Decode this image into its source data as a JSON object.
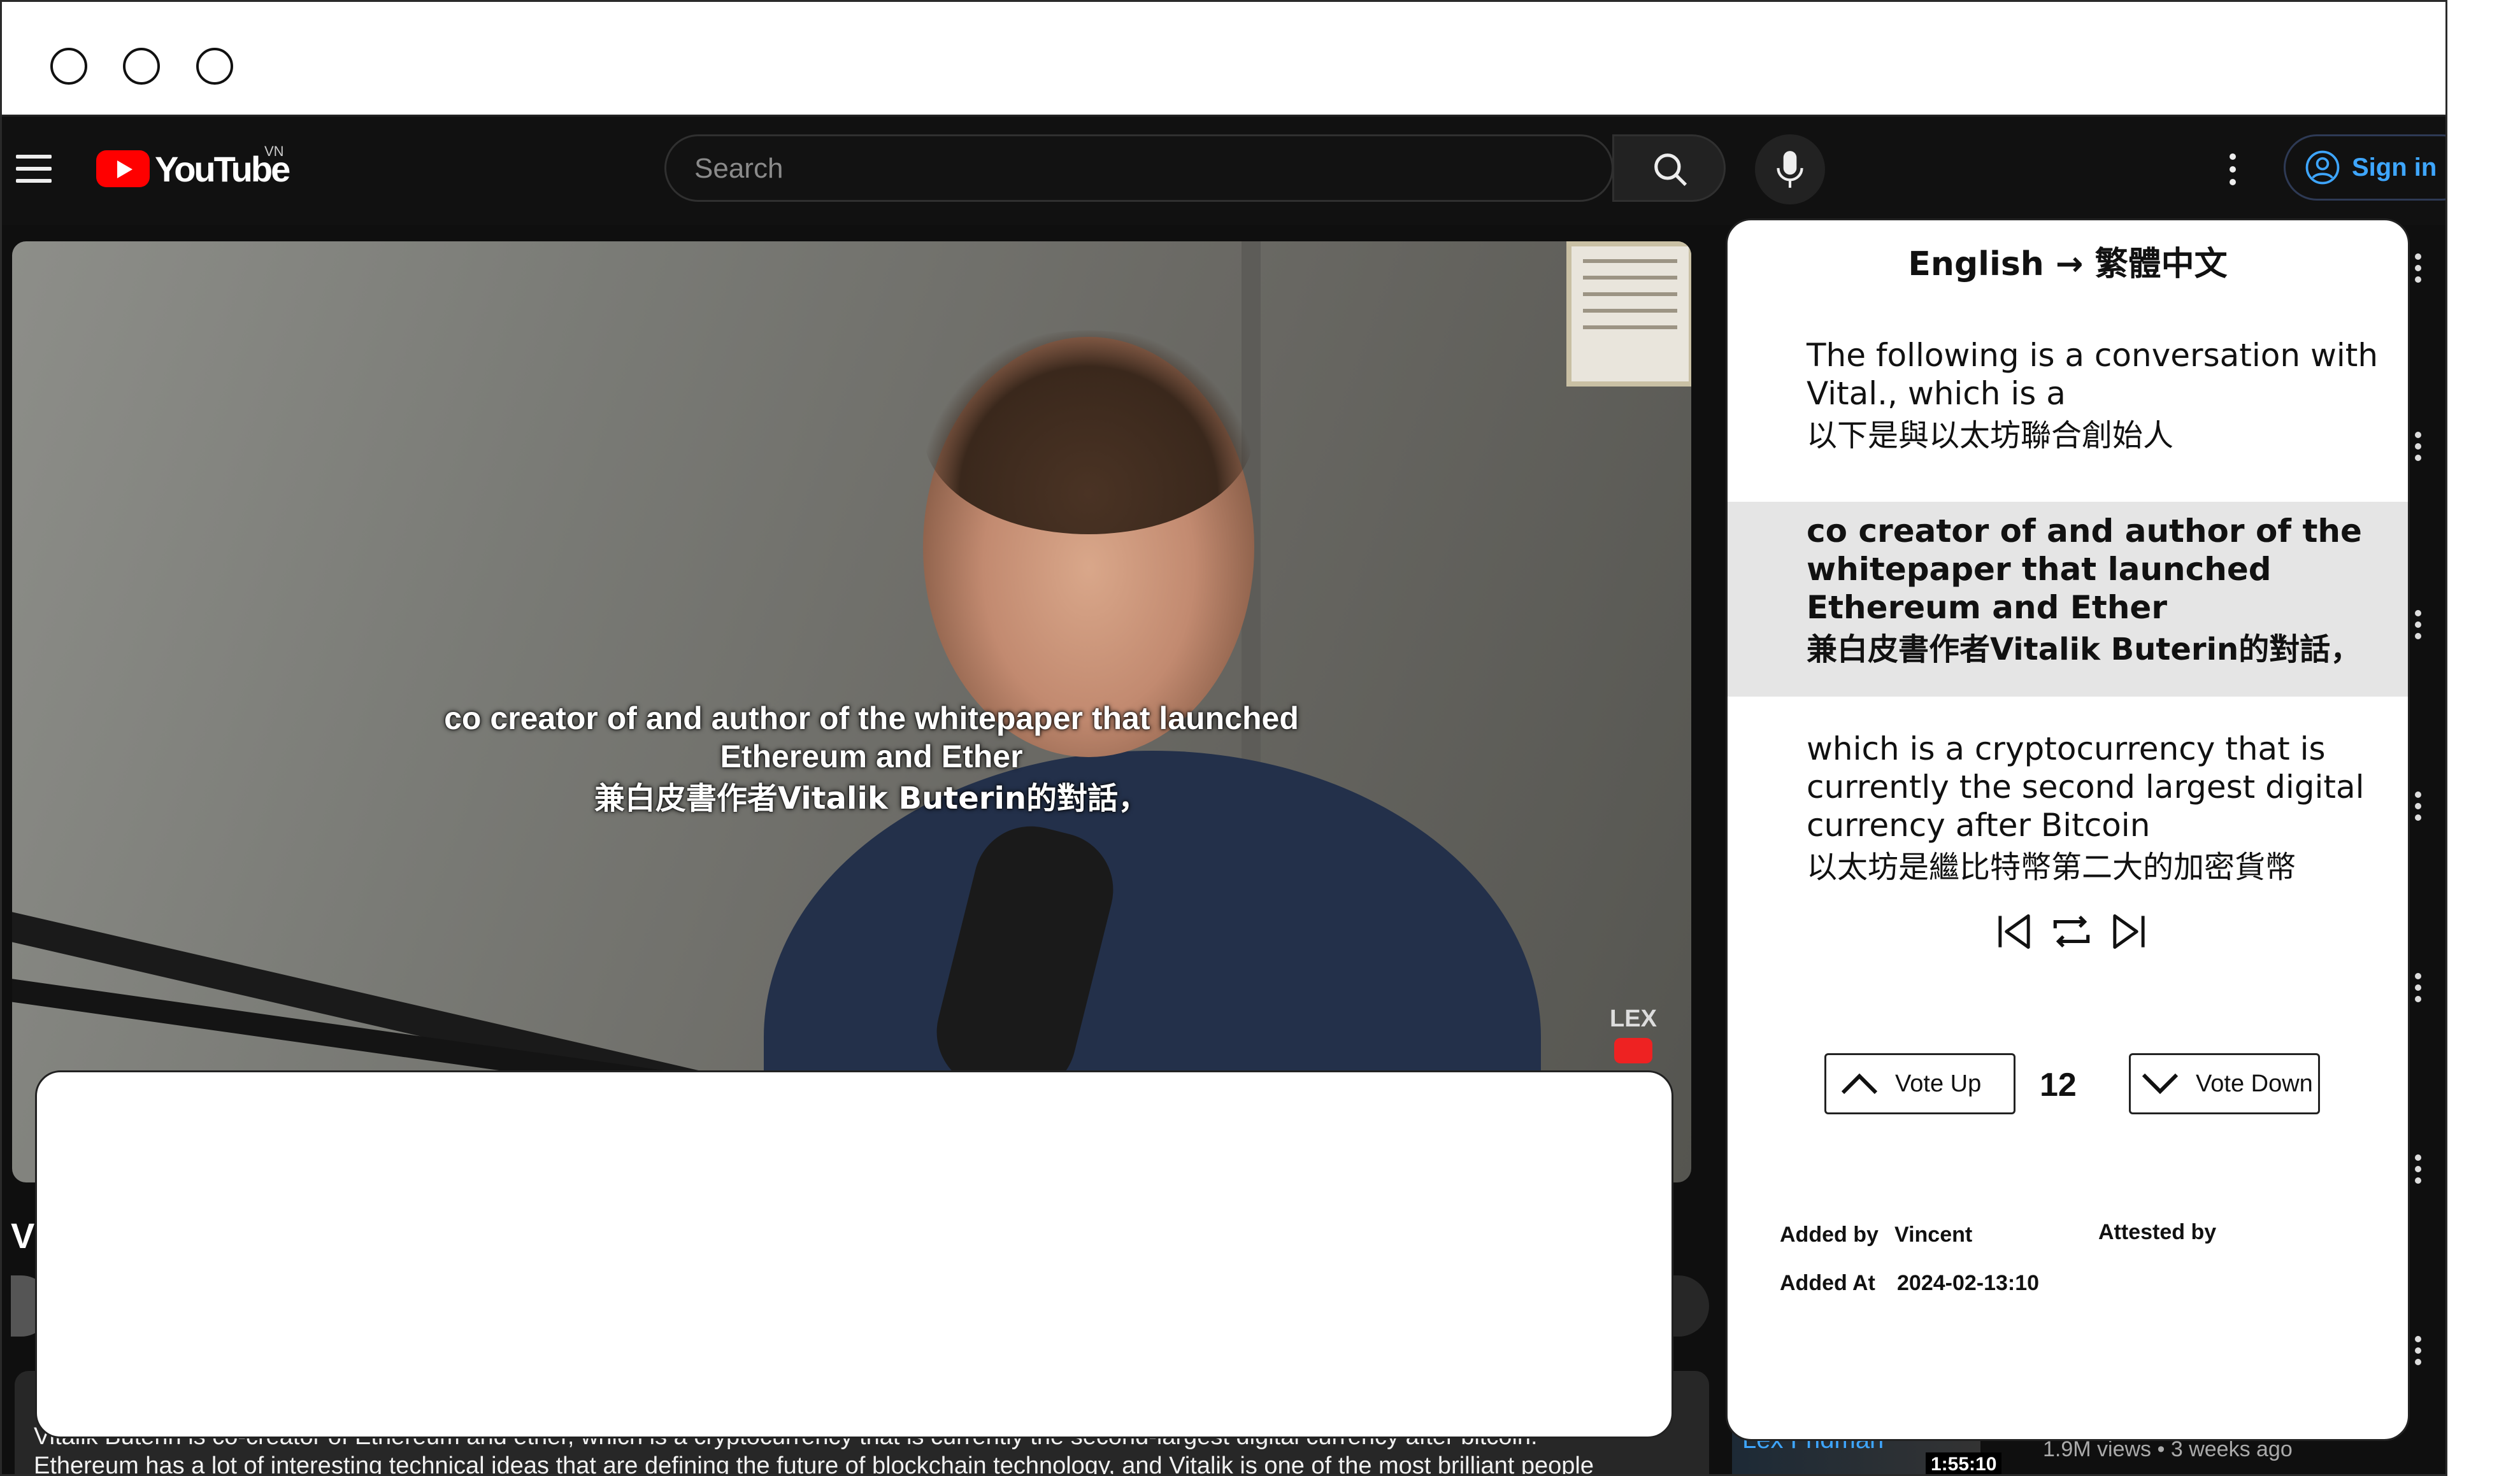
{
  "window": {
    "controls": [
      "close",
      "minimize",
      "maximize"
    ]
  },
  "header": {
    "logo_text": "YouTube",
    "region": "VN",
    "search_placeholder": "Search",
    "signin_label": "Sign in"
  },
  "video": {
    "caption_en": "co creator of and author of the whitepaper that launched Ethereum and Ether",
    "caption_zh": "兼白皮書作者Vitalik Buterin的對話，",
    "watermark": "LEX"
  },
  "page": {
    "title_peek": "V",
    "description_line1": "Vitalik Buterin is co-creator of Ethereum and ether, which is a cryptocurrency that is currently the second-largest digital currency after bitcoin.",
    "description_line2": "Ethereum has a lot of interesting technical ideas that are defining the future of blockchain technology, and Vitalik is one of the most brilliant people"
  },
  "translation_panel": {
    "language_pair": "English → 繁體中文",
    "segments": [
      {
        "en": "The following is a conversation with Vital., which is a",
        "zh": "以下是與以太坊聯合創始人"
      },
      {
        "en": "co creator of and author of the whitepaper that launched Ethereum and Ether",
        "zh": "兼白皮書作者Vitalik Buterin的對話，"
      },
      {
        "en": "which is a cryptocurrency that is currently the second largest digital currency after Bitcoin",
        "zh": "以太坊是繼比特幣第二大的加密貨幣"
      }
    ],
    "vote_up_label": "Vote Up",
    "vote_count": "12",
    "vote_down_label": "Vote Down",
    "added_by_label": "Added by",
    "added_by_value": "Vincent",
    "attested_by_label": "Attested by",
    "added_at_label": "Added At",
    "added_at_value": "2024-02-13:10"
  },
  "recommendation": {
    "channel": "Lex Fridman",
    "duration": "1:55:10",
    "meta": "1.9M views  •  3 weeks ago"
  },
  "colors": {
    "accent": "#3ea6ff",
    "brand_red": "#ff0000",
    "background": "#0f0f0f"
  }
}
